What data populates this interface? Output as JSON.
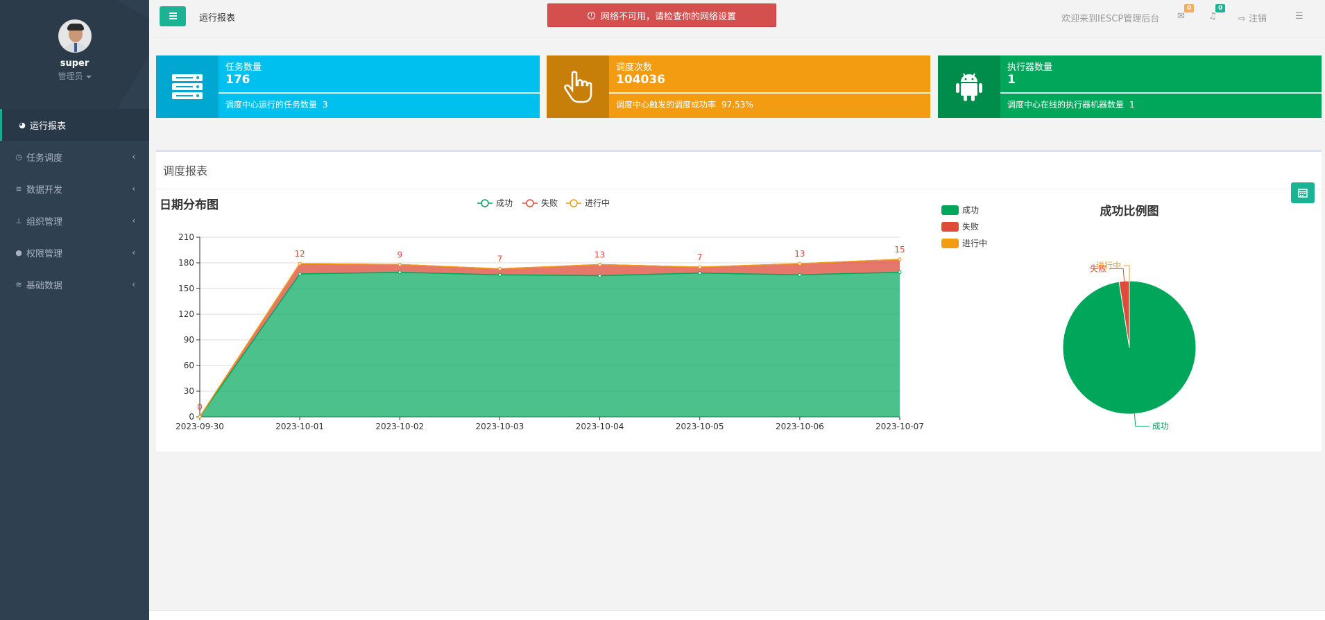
{
  "sidebar": {
    "user": "super",
    "role": "管理员",
    "items": [
      {
        "label": "运行报表",
        "active": true
      },
      {
        "label": "任务调度"
      },
      {
        "label": "数据开发"
      },
      {
        "label": "组织管理"
      },
      {
        "label": "权限管理"
      },
      {
        "label": "基础数据"
      }
    ]
  },
  "topbar": {
    "page_name": "运行报表",
    "alert": "网络不可用，请检查你的网络设置",
    "welcome": "欢迎来到IESCP管理后台",
    "mail_count": "0",
    "bell_count": "0",
    "logout": "注销"
  },
  "stats": [
    {
      "label": "任务数量",
      "value": "176",
      "desc": "调度中心运行的任务数量",
      "desc_value": "3",
      "color": "#00c0ef",
      "icon_bg": "#00a7d0"
    },
    {
      "label": "调度次数",
      "value": "104036",
      "desc": "调度中心触发的调度成功率",
      "desc_value": "97.53%",
      "color": "#f39c12",
      "icon_bg": "#c87f0a"
    },
    {
      "label": "执行器数量",
      "value": "1",
      "desc": "调度中心在线的执行器机器数量",
      "desc_value": "1",
      "color": "#00a65a",
      "icon_bg": "#008d4c"
    }
  ],
  "panel": {
    "title": "调度报表"
  },
  "chart_data": [
    {
      "type": "area",
      "title": "日期分布图",
      "x": [
        "2023-09-30",
        "2023-10-01",
        "2023-10-02",
        "2023-10-03",
        "2023-10-04",
        "2023-10-05",
        "2023-10-06",
        "2023-10-07"
      ],
      "ylim": [
        0,
        210
      ],
      "yticks": [
        0,
        30,
        60,
        90,
        120,
        150,
        180,
        210
      ],
      "stacked": true,
      "legend_position": "top-center",
      "series": [
        {
          "name": "成功",
          "values": [
            0,
            167,
            169,
            166,
            165,
            168,
            166,
            169
          ],
          "color": "#00a65a"
        },
        {
          "name": "失败",
          "values": [
            0,
            12,
            9,
            7,
            13,
            7,
            13,
            15
          ],
          "color": "#dd4b39"
        },
        {
          "name": "进行中",
          "values": [
            0,
            0,
            0,
            0,
            0,
            0,
            0,
            0
          ],
          "color": "#f39c12"
        }
      ],
      "data_labels": [
        "0",
        "12",
        "9",
        "7",
        "13",
        "7",
        "13",
        "15"
      ]
    },
    {
      "type": "pie",
      "title": "成功比例图",
      "legend_position": "top-left",
      "slices": [
        {
          "name": "成功",
          "value": 97.53,
          "color": "#00a65a"
        },
        {
          "name": "失败",
          "value": 2.47,
          "color": "#dd4b39"
        },
        {
          "name": "进行中",
          "value": 0.0,
          "color": "#f39c12"
        }
      ]
    }
  ]
}
